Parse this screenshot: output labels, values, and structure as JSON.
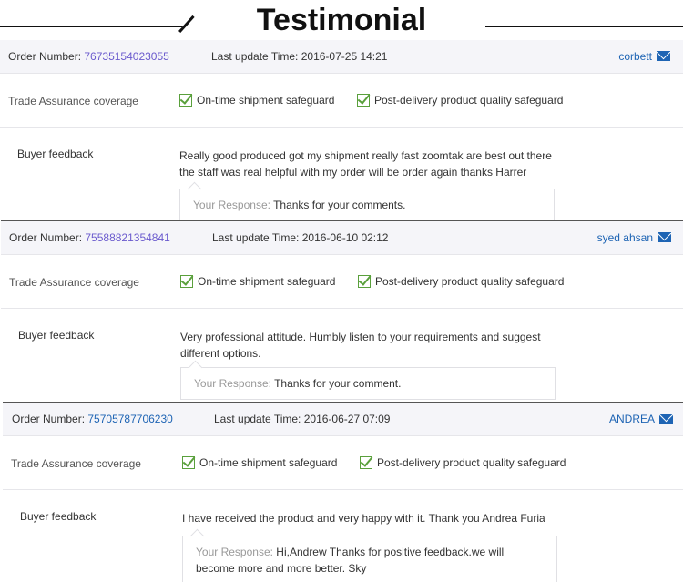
{
  "header": {
    "title": "Testimonial"
  },
  "labels": {
    "order_number": "Order Number:",
    "last_update": "Last update Time:",
    "trade_assurance": "Trade Assurance coverage",
    "ontime": "On-time shipment safeguard",
    "postdelivery": "Post-delivery product quality safeguard",
    "buyer_feedback": "Buyer feedback",
    "your_response": "Your Response:"
  },
  "icons": {
    "mail": "envelope-icon",
    "check": "checkbox-check-icon"
  },
  "colors": {
    "link": "#1e64b4",
    "check": "#5aa03c",
    "bar": "#f5f5f9"
  },
  "reviews": [
    {
      "order_number": "76735154023055",
      "last_update": "2016-07-25 14:21",
      "buyer": "corbett",
      "feedback": "Really good produced got my shipment really fast zoomtak are best out there the staff was real helpful with my order will be order again thanks Harrer",
      "response": "Thanks for your comments."
    },
    {
      "order_number": "75588821354841",
      "last_update": "2016-06-10 02:12",
      "buyer": "syed ahsan",
      "feedback": "Very professional attitude. Humbly listen to your requirements and suggest different options.",
      "response": "Thanks for your comment."
    },
    {
      "order_number": "75705787706230",
      "last_update": "2016-06-27 07:09",
      "buyer": "ANDREA",
      "feedback": "I have received the product and very happy with it. Thank you Andrea Furia",
      "response": "Hi,Andrew Thanks for positive feedback.we will become more and more better. Sky"
    }
  ]
}
